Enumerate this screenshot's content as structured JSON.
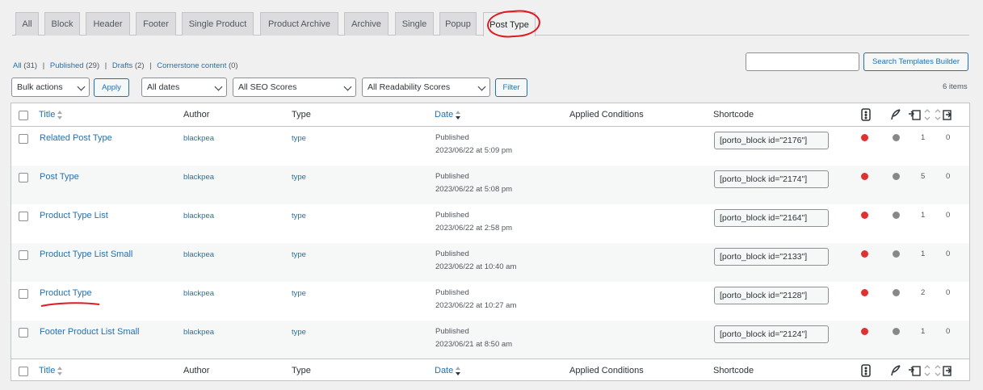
{
  "tabs": [
    {
      "label": "All",
      "active": false
    },
    {
      "label": "Block",
      "active": false
    },
    {
      "label": "Header",
      "active": false
    },
    {
      "label": "Footer",
      "active": false
    },
    {
      "label": "Single Product",
      "active": false
    },
    {
      "label": "Product Archive",
      "active": false
    },
    {
      "label": "Archive",
      "active": false
    },
    {
      "label": "Single",
      "active": false
    },
    {
      "label": "Popup",
      "active": false
    },
    {
      "label": "Post Type",
      "active": true
    }
  ],
  "subsubsub": {
    "all": {
      "label": "All",
      "count": "(31)"
    },
    "published": {
      "label": "Published",
      "count": "(29)"
    },
    "drafts": {
      "label": "Drafts",
      "count": "(2)"
    },
    "cornerstone": {
      "label": "Cornerstone content",
      "count": "(0)"
    }
  },
  "search": {
    "value": "",
    "button_label": "Search Templates Builder"
  },
  "filters": {
    "bulk_actions": "Bulk actions",
    "apply_label": "Apply",
    "dates": "All dates",
    "seo_scores": "All SEO Scores",
    "readability_scores": "All Readability Scores",
    "filter_label": "Filter",
    "items_count": "6 items"
  },
  "columns": {
    "title": "Title",
    "author": "Author",
    "type": "Type",
    "date": "Date",
    "applied": "Applied Conditions",
    "shortcode": "Shortcode"
  },
  "colors": {
    "seo_red": "#dc3232",
    "readability_gray": "#888888",
    "link": "#2271b1"
  },
  "rows": [
    {
      "title": "Related Post Type",
      "author": "blackpea",
      "type": "type",
      "status": "Published",
      "date": "2023/06/22 at 5:09 pm",
      "shortcode": "[porto_block id=\"2176\"]",
      "links_in": "1",
      "links_out": "0"
    },
    {
      "title": "Post Type",
      "author": "blackpea",
      "type": "type",
      "status": "Published",
      "date": "2023/06/22 at 5:08 pm",
      "shortcode": "[porto_block id=\"2174\"]",
      "links_in": "5",
      "links_out": "0"
    },
    {
      "title": "Product Type List",
      "author": "blackpea",
      "type": "type",
      "status": "Published",
      "date": "2023/06/22 at 2:58 pm",
      "shortcode": "[porto_block id=\"2164\"]",
      "links_in": "1",
      "links_out": "0"
    },
    {
      "title": "Product Type List Small",
      "author": "blackpea",
      "type": "type",
      "status": "Published",
      "date": "2023/06/22 at 10:40 am",
      "shortcode": "[porto_block id=\"2133\"]",
      "links_in": "1",
      "links_out": "0"
    },
    {
      "title": "Product Type",
      "author": "blackpea",
      "type": "type",
      "status": "Published",
      "date": "2023/06/22 at 10:27 am",
      "shortcode": "[porto_block id=\"2128\"]",
      "links_in": "2",
      "links_out": "0"
    },
    {
      "title": "Footer Product List Small",
      "author": "blackpea",
      "type": "type",
      "status": "Published",
      "date": "2023/06/21 at 8:50 am",
      "shortcode": "[porto_block id=\"2124\"]",
      "links_in": "1",
      "links_out": "0"
    }
  ]
}
